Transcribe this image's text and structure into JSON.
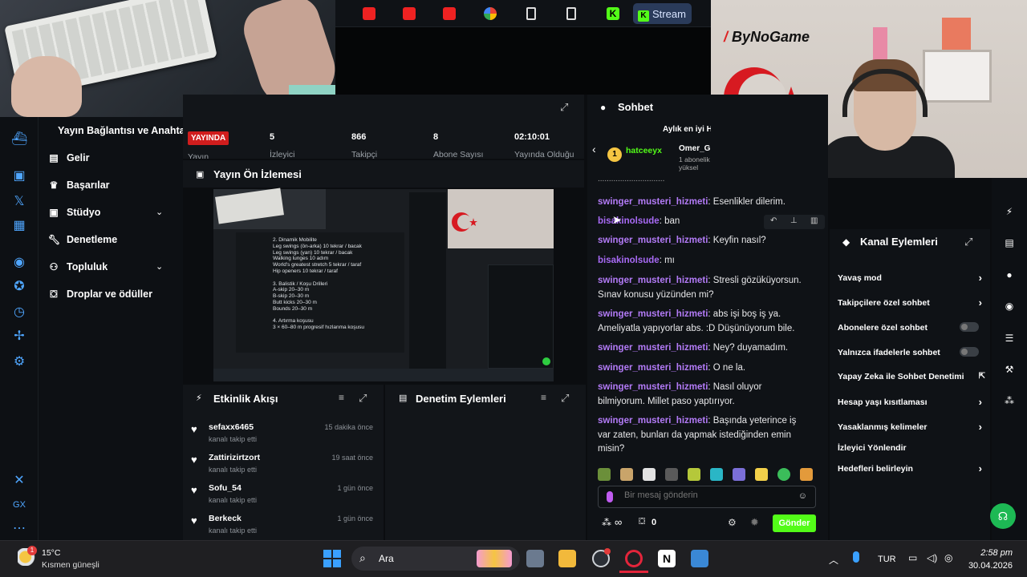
{
  "browser": {
    "stream_tab_label": "Stream"
  },
  "webcam": {
    "logo": "ByNoGame"
  },
  "sidebar": {
    "title": "Yayın Bağlantısı ve Anahtarı",
    "items": [
      {
        "label": "Gelir",
        "icon": "chart-icon"
      },
      {
        "label": "Başarılar",
        "icon": "trophy-icon"
      },
      {
        "label": "Stüdyo",
        "icon": "studio-icon",
        "expandable": true
      },
      {
        "label": "Denetleme",
        "icon": "wrench-icon"
      },
      {
        "label": "Topluluk",
        "icon": "people-icon",
        "expandable": true
      },
      {
        "label": "Droplar ve ödüller",
        "icon": "gift-icon"
      }
    ]
  },
  "stats": {
    "live_badge": "YAYINDA",
    "live_sub": "Yayın",
    "viewers_value": "5",
    "viewers_label": "İzleyici",
    "followers_value": "866",
    "followers_label": "Takipçi",
    "subs_value": "8",
    "subs_label": "Abone Sayısı",
    "uptime_value": "02:10:01",
    "uptime_label": "Yayında Olduğu"
  },
  "preview": {
    "title": "Yayın Ön İzlemesi",
    "notes": [
      "2. Dinamik Mobilite",
      "Leg swings (ön-arka) 10 tekrar / bacak",
      "Leg swings (yan) 10 tekrar / bacak",
      "Walking lunges 10 adım",
      "World's greatest stretch 5 tekrar / taraf",
      "Hip openers 10 tekrar / taraf",
      "",
      "3. Balistik / Koşu Drilleri",
      "A-skip 20–30 m",
      "B-skip 20–30 m",
      "Butt kicks 20–30 m",
      "Bounds 20–30 m",
      "",
      "4. Artırma koşusu",
      "3 × 60–80 m progresif hızlanma koşusu"
    ]
  },
  "activity": {
    "title": "Etkinlik Akışı",
    "items": [
      {
        "name": "sefaxx6465",
        "action": "kanalı takip etti",
        "time": "15 dakika önce"
      },
      {
        "name": "Zattirizirtzort",
        "action": "kanalı takip etti",
        "time": "19 saat önce"
      },
      {
        "name": "Sofu_54",
        "action": "kanalı takip etti",
        "time": "1 gün önce"
      },
      {
        "name": "Berkeck",
        "action": "kanalı takip etti",
        "time": "1 gün önce"
      }
    ]
  },
  "moderation": {
    "title": "Denetim Eylemleri"
  },
  "chat": {
    "title": "Sohbet",
    "top_label": "Aylık en iyi H",
    "gifter_name": "hatceeyx",
    "gifter_count": "1",
    "second_name": "Omer_G",
    "second_sub": "1 abonelik yüksel",
    "messages": [
      {
        "user": "swinger_musteri_hizmeti",
        "text": ": Esenlikler dilerim."
      },
      {
        "user": "bisakinolsude",
        "text": ": ban"
      },
      {
        "user": "swinger_musteri_hizmeti",
        "text": ": Keyfin nasıl?"
      },
      {
        "user": "bisakinolsude",
        "text": ": mı"
      },
      {
        "user": "swinger_musteri_hizmeti",
        "text": ": Stresli gözüküyorsun. Sınav konusu yüzünden mi?"
      },
      {
        "user": "swinger_musteri_hizmeti",
        "text": ": abs işi boş iş ya. Ameliyatla yapıyorlar abs. :D Düşünüyorum bile."
      },
      {
        "user": "swinger_musteri_hizmeti",
        "text": ": Ney? duyamadım."
      },
      {
        "user": "swinger_musteri_hizmeti",
        "text": ": O ne la."
      },
      {
        "user": "swinger_musteri_hizmeti",
        "text": ": Nasıl oluyor bilmiyorum. Millet paso yaptırıyor."
      },
      {
        "user": "swinger_musteri_hizmeti",
        "text": ": Başında yeterince iş var zaten, bunları da yapmak istediğinden emin misin?"
      }
    ],
    "input_placeholder": "Bir mesaj gönderin",
    "send_label": "Gönder",
    "infinity_label": "∞",
    "points_value": "0"
  },
  "channel_actions": {
    "title": "Kanal Eylemleri",
    "items": [
      {
        "label": "Yavaş mod",
        "control": "chevron"
      },
      {
        "label": "Takipçilere özel sohbet",
        "control": "chevron"
      },
      {
        "label": "Abonelere özel sohbet",
        "control": "toggle"
      },
      {
        "label": "Yalnızca ifadelerle sohbet",
        "control": "toggle"
      },
      {
        "label": "Yapay Zeka ile Sohbet Denetimi",
        "control": "external"
      },
      {
        "label": "Hesap yaşı kısıtlaması",
        "control": "chevron"
      },
      {
        "label": "Yasaklanmış kelimeler",
        "control": "chevron"
      },
      {
        "label": "İzleyici Yönlendir",
        "control": "none"
      },
      {
        "label": "Hedefleri belirleyin",
        "control": "chevron"
      }
    ]
  },
  "taskbar": {
    "temperature": "15°C",
    "weather": "Kısmen güneşli",
    "weather_badge": "1",
    "search_label": "Ara",
    "language": "TUR",
    "time": "2:58 pm",
    "date": "30.04.2026"
  },
  "colors": {
    "kick_green": "#53fc18",
    "live_red": "#d01d1d",
    "chat_user_purple": "#b37bf7",
    "accent_blue": "#4fa6ff"
  }
}
